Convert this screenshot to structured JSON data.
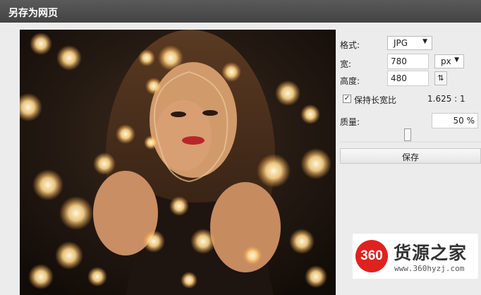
{
  "window": {
    "title": "另存为网页"
  },
  "options": {
    "format_label": "格式:",
    "format_value": "JPG",
    "width_label": "宽:",
    "width_value": "780",
    "unit_value": "px",
    "height_label": "高度:",
    "height_value": "480",
    "keep_ratio_label": "保持长宽比",
    "keep_ratio_checked": true,
    "ratio_text": "1.625 : 1",
    "quality_label": "质量:",
    "quality_value": "50 %",
    "quality_fraction": 0.5,
    "save_label": "保存"
  },
  "preview": {
    "description_icon": "photo-preview",
    "palette": {
      "bg": "#1a130e",
      "skin": "#c98e63",
      "light": "#ffe9b0",
      "glow": "#f7b25a"
    }
  },
  "watermark": {
    "badge": "360",
    "title": "货源之家",
    "url": "www.360hyzj.com",
    "brand_color": "#e0221f"
  }
}
